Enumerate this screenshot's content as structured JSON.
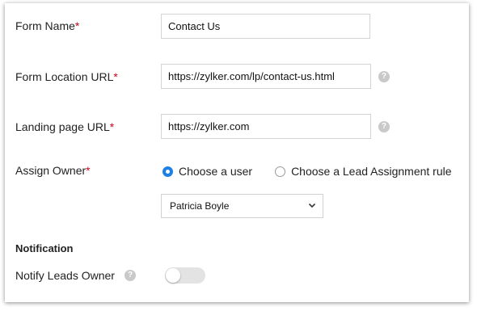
{
  "form": {
    "form_name": {
      "label": "Form Name",
      "required_mark": "*",
      "value": "Contact Us"
    },
    "form_location_url": {
      "label": "Form Location URL",
      "required_mark": "*",
      "value": "https://zylker.com/lp/contact-us.html"
    },
    "landing_page_url": {
      "label": "Landing page URL",
      "required_mark": "*",
      "value": "https://zylker.com"
    },
    "assign_owner": {
      "label": "Assign Owner",
      "required_mark": "*",
      "options": [
        {
          "label": "Choose a user",
          "selected": true
        },
        {
          "label": "Choose a Lead Assignment rule",
          "selected": false
        }
      ],
      "selected_user": "Patricia Boyle"
    }
  },
  "notification": {
    "section_title": "Notification",
    "notify_leads_owner": {
      "label": "Notify Leads Owner",
      "enabled": false
    }
  },
  "help_icon_glyph": "?",
  "colors": {
    "accent": "#1e7fe6",
    "required": "#d0021b",
    "help_icon": "#c9c9c9",
    "toggle_off": "#e3e3e3"
  }
}
